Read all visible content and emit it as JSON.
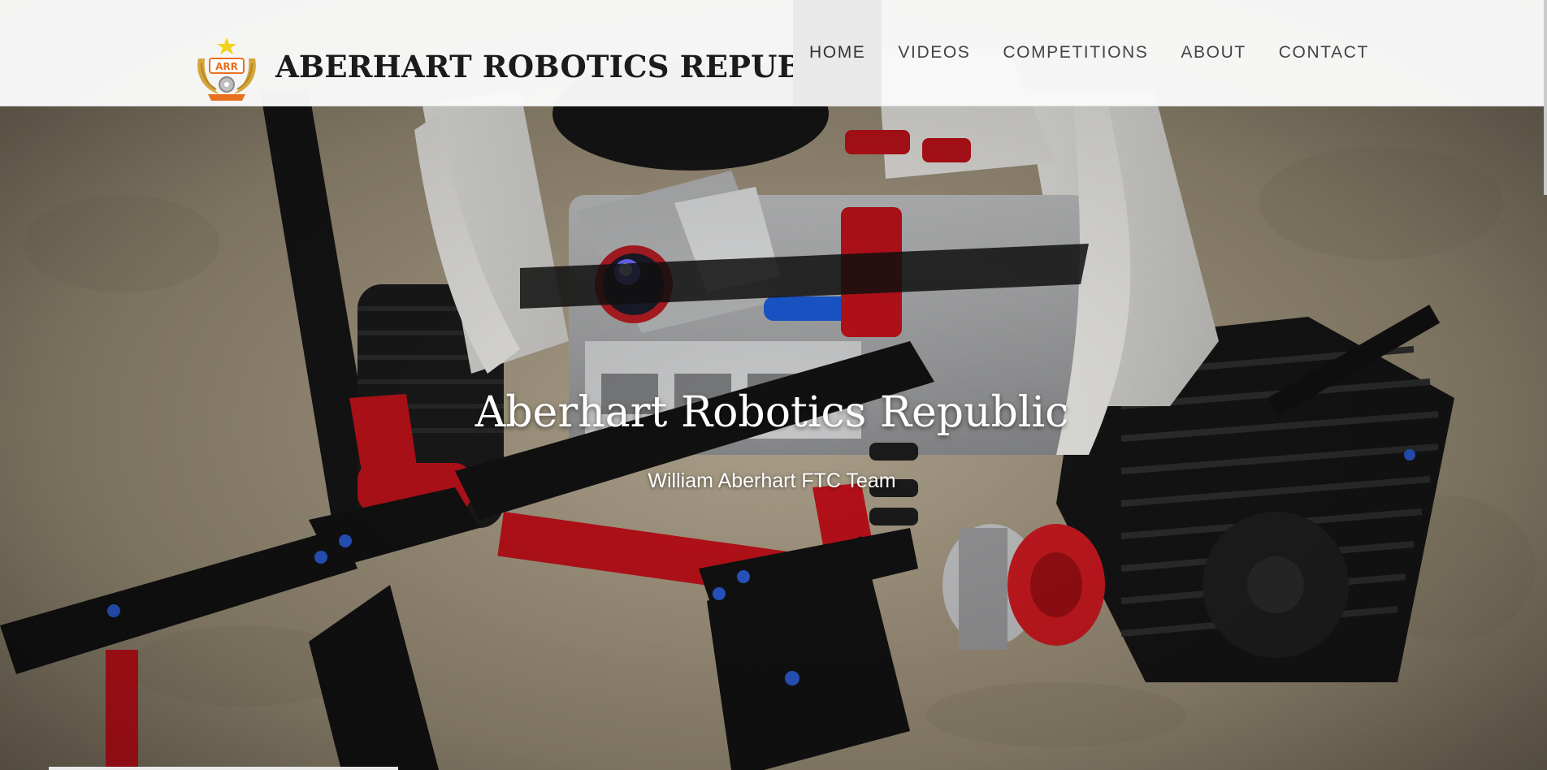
{
  "site": {
    "brand_name": "ABERHART ROBOTICS REPUBLIC",
    "logo_letters": "ARR"
  },
  "nav": {
    "items": [
      {
        "label": "HOME",
        "active": true
      },
      {
        "label": "VIDEOS",
        "active": false
      },
      {
        "label": "COMPETITIONS",
        "active": false
      },
      {
        "label": "ABOUT",
        "active": false
      },
      {
        "label": "CONTACT",
        "active": false
      }
    ]
  },
  "hero": {
    "title": "Aberhart Robotics Republic",
    "subtitle": "William Aberhart FTC Team",
    "background_subject": "lego-robot-photo"
  },
  "colors": {
    "header_bg": "#fafafa",
    "nav_active_bg": "#e9e9e9",
    "nav_text": "#444444",
    "brand_text": "#1b1b1b",
    "hero_text": "#ffffff",
    "logo_gold": "#d4a53a",
    "logo_orange": "#e8701e"
  }
}
